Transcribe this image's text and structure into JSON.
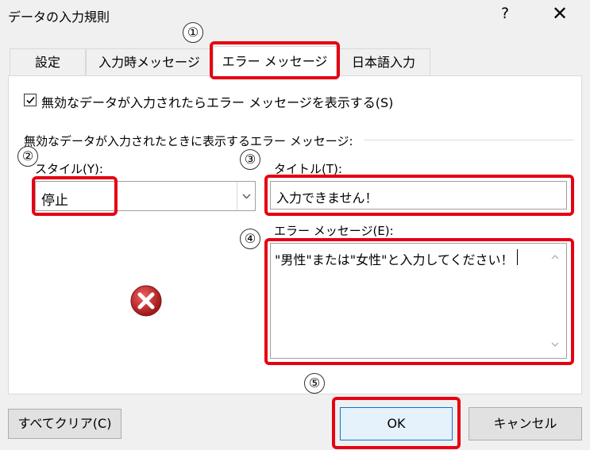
{
  "window": {
    "title": "データの入力規則",
    "help_glyph": "?",
    "close_glyph": "✕"
  },
  "tabs": [
    {
      "label": "設定"
    },
    {
      "label": "入力時メッセージ"
    },
    {
      "label": "エラー メッセージ"
    },
    {
      "label": "日本語入力"
    }
  ],
  "error_tab": {
    "show_error_checkbox": {
      "checked": true,
      "label": "無効なデータが入力されたらエラー メッセージを表示する(S)"
    },
    "group_label": "無効なデータが入力されたときに表示するエラー メッセージ:",
    "style_label": "スタイル(Y):",
    "style_value": "停止",
    "title_label": "タイトル(T):",
    "title_value": "入力できません！",
    "message_label": "エラー メッセージ(E):",
    "message_value": "\"男性\"または\"女性\"と入力してください！"
  },
  "annotations": [
    "①",
    "②",
    "③",
    "④",
    "⑤"
  ],
  "buttons": {
    "clear_all": "すべてクリア(C)",
    "ok": "OK",
    "cancel": "キャンセル"
  },
  "colors": {
    "highlight_red": "#e60012",
    "stop_icon_red": "#c1272d",
    "ok_border": "#0078d7"
  }
}
